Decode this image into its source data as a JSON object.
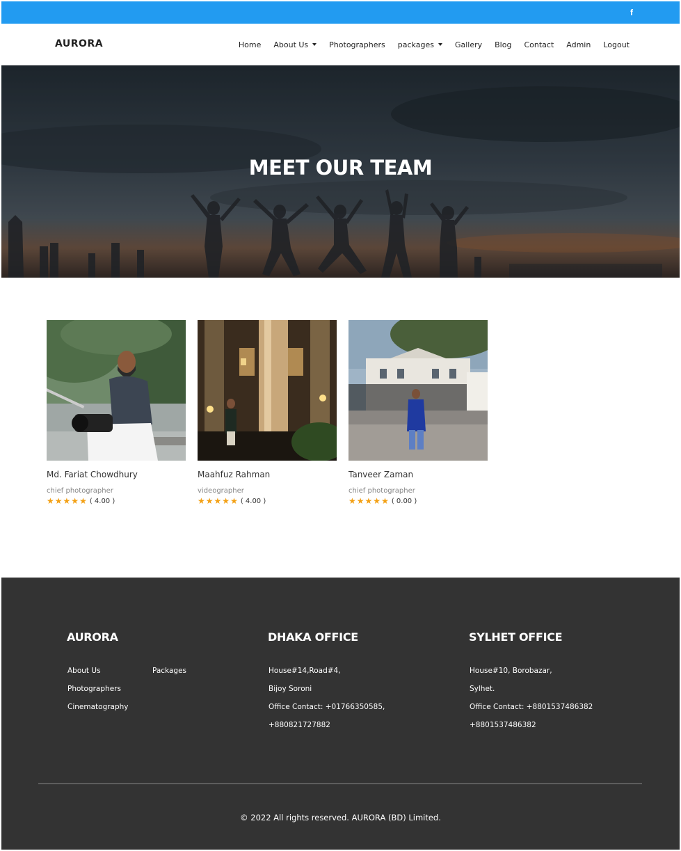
{
  "topbar": {
    "social_icon": "facebook-icon",
    "social_glyph": "f",
    "color": "#229bf1"
  },
  "nav": {
    "brand": "AURORA",
    "items": [
      {
        "label": "Home",
        "dropdown": false
      },
      {
        "label": "About Us",
        "dropdown": true
      },
      {
        "label": "Photographers",
        "dropdown": false
      },
      {
        "label": "packages",
        "dropdown": true
      },
      {
        "label": "Gallery",
        "dropdown": false
      },
      {
        "label": "Blog",
        "dropdown": false
      },
      {
        "label": "Contact",
        "dropdown": false
      },
      {
        "label": "Admin",
        "dropdown": false
      },
      {
        "label": "Logout",
        "dropdown": false
      }
    ]
  },
  "hero": {
    "title": "MEET OUR TEAM"
  },
  "team": [
    {
      "name": "Md. Fariat Chowdhury",
      "role": "chief photographer",
      "rating": "( 4.00 )",
      "stars": 5
    },
    {
      "name": "Maahfuz Rahman",
      "role": "videographer",
      "rating": "( 4.00 )",
      "stars": 5
    },
    {
      "name": "Tanveer Zaman",
      "role": "chief photographer",
      "rating": "( 0.00 )",
      "stars": 5
    }
  ],
  "footer": {
    "brand": "AURORA",
    "links_col1": [
      "About Us",
      "Photographers",
      "Cinematography"
    ],
    "links_col2": [
      "Packages"
    ],
    "dhaka": {
      "title": "DHAKA OFFICE",
      "lines": [
        "House#14,Road#4,",
        "Bijoy Soroni",
        "Office Contact: +01766350585,",
        "+880821727882"
      ]
    },
    "sylhet": {
      "title": "SYLHET OFFICE",
      "lines": [
        "House#10, Borobazar,",
        "Sylhet.",
        "Office Contact: +8801537486382",
        "+8801537486382"
      ]
    },
    "copyright": "© 2022 All rights reserved. AURORA (BD) Limited."
  },
  "colors": {
    "accent": "#229bf1",
    "star": "#f3a014",
    "footer_bg": "#333333"
  }
}
